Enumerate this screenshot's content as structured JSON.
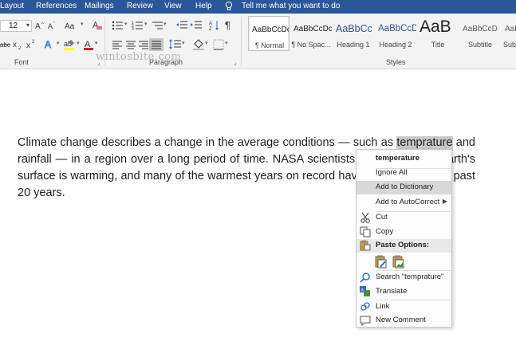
{
  "tabs": {
    "layout": "Layout",
    "references": "References",
    "mailings": "Mailings",
    "review": "Review",
    "view": "View",
    "help": "Help",
    "tell_me": "Tell me what you want to do"
  },
  "ribbon": {
    "font_size": "12",
    "font_group_label": "Font",
    "paragraph_group_label": "Paragraph",
    "styles_group_label": "Styles",
    "styles": [
      {
        "sample": "AaBbCcDc",
        "name": "¶ Normal"
      },
      {
        "sample": "AaBbCcDc",
        "name": "¶ No Spac..."
      },
      {
        "sample": "AaBbCc",
        "name": "Heading 1"
      },
      {
        "sample": "AaBbCcD",
        "name": "Heading 2"
      },
      {
        "sample": "AaB",
        "name": "Title"
      },
      {
        "sample": "AaBbCcD",
        "name": "Subtitle"
      },
      {
        "sample": "AaBbCcD",
        "name": "Subt"
      }
    ],
    "watermark": "wintosbite.com"
  },
  "document": {
    "before": "Climate change describes a change in the average conditions — such as ",
    "misspelled": "temprature",
    "after": " and rainfall — in a region over a long period of time. NASA scientists have observed Earth's surface is warming, and many of the warmest years on record have happened in the past 20 years."
  },
  "context_menu": {
    "suggestion": "temperature",
    "ignore_all": "Ignore All",
    "add_to_dictionary": "Add to Dictionary",
    "add_to_autocorrect": "Add to AutoCorrect",
    "cut": "Cut",
    "copy": "Copy",
    "paste_options": "Paste Options:",
    "search": "Search \"temprature\"",
    "translate": "Translate",
    "link": "Link",
    "new_comment": "New Comment"
  },
  "colors": {
    "title_bar": "#2b579a",
    "highlight": "#d8d8d8",
    "spell_underline": "#d21b1b"
  }
}
